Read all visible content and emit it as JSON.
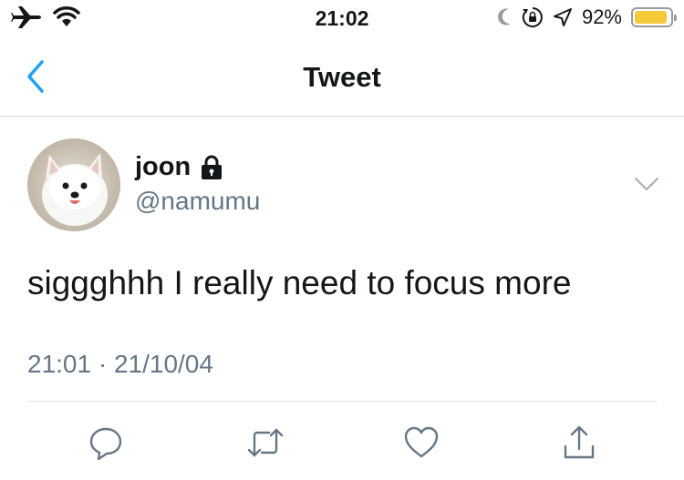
{
  "status_bar": {
    "time": "21:02",
    "battery_percent": "92%",
    "battery_level": 0.92,
    "icons": [
      "airplane-icon",
      "wifi-icon",
      "moon-icon",
      "rotation-lock-icon",
      "location-arrow-icon",
      "battery-icon"
    ]
  },
  "nav": {
    "title": "Tweet",
    "back_icon": "chevron-left-icon"
  },
  "tweet": {
    "author_name": "joon",
    "author_handle": "@namumu",
    "protected_icon": "lock-icon",
    "text": "sigggh​hh I really need to focus more",
    "timestamp": "21:01 · 21/10/04",
    "menu_icon": "chevron-down-icon"
  },
  "actions": [
    "reply-icon",
    "retweet-icon",
    "like-icon",
    "share-icon"
  ],
  "colors": {
    "accent": "#1da1f2",
    "secondary_text": "#657786",
    "battery": "#f6c93b"
  }
}
